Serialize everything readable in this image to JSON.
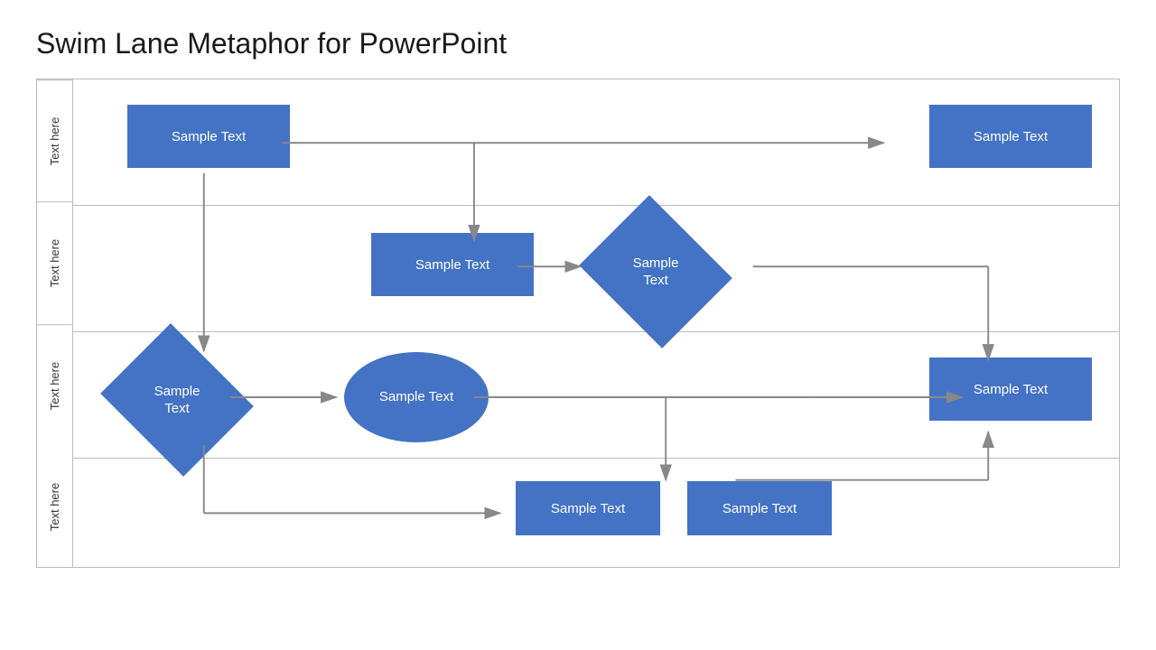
{
  "title": "Swim Lane Metaphor for PowerPoint",
  "lanes": [
    {
      "label": "Text here"
    },
    {
      "label": "Text here"
    },
    {
      "label": "Text here"
    },
    {
      "label": "Text here"
    }
  ],
  "shapes": {
    "lane1_rect1": "Sample Text",
    "lane1_rect2": "Sample Text",
    "lane2_rect1": "Sample Text",
    "lane2_diamond": "Sample\nText",
    "lane3_diamond": "Sample\nText",
    "lane3_ellipse": "Sample\nText",
    "lane3_rect": "Sample Text",
    "lane4_rect1": "Sample Text",
    "lane4_rect2": "Sample Text"
  },
  "colors": {
    "blue": "#4472c4",
    "arrow": "#888888",
    "border": "#bbbbbb"
  }
}
